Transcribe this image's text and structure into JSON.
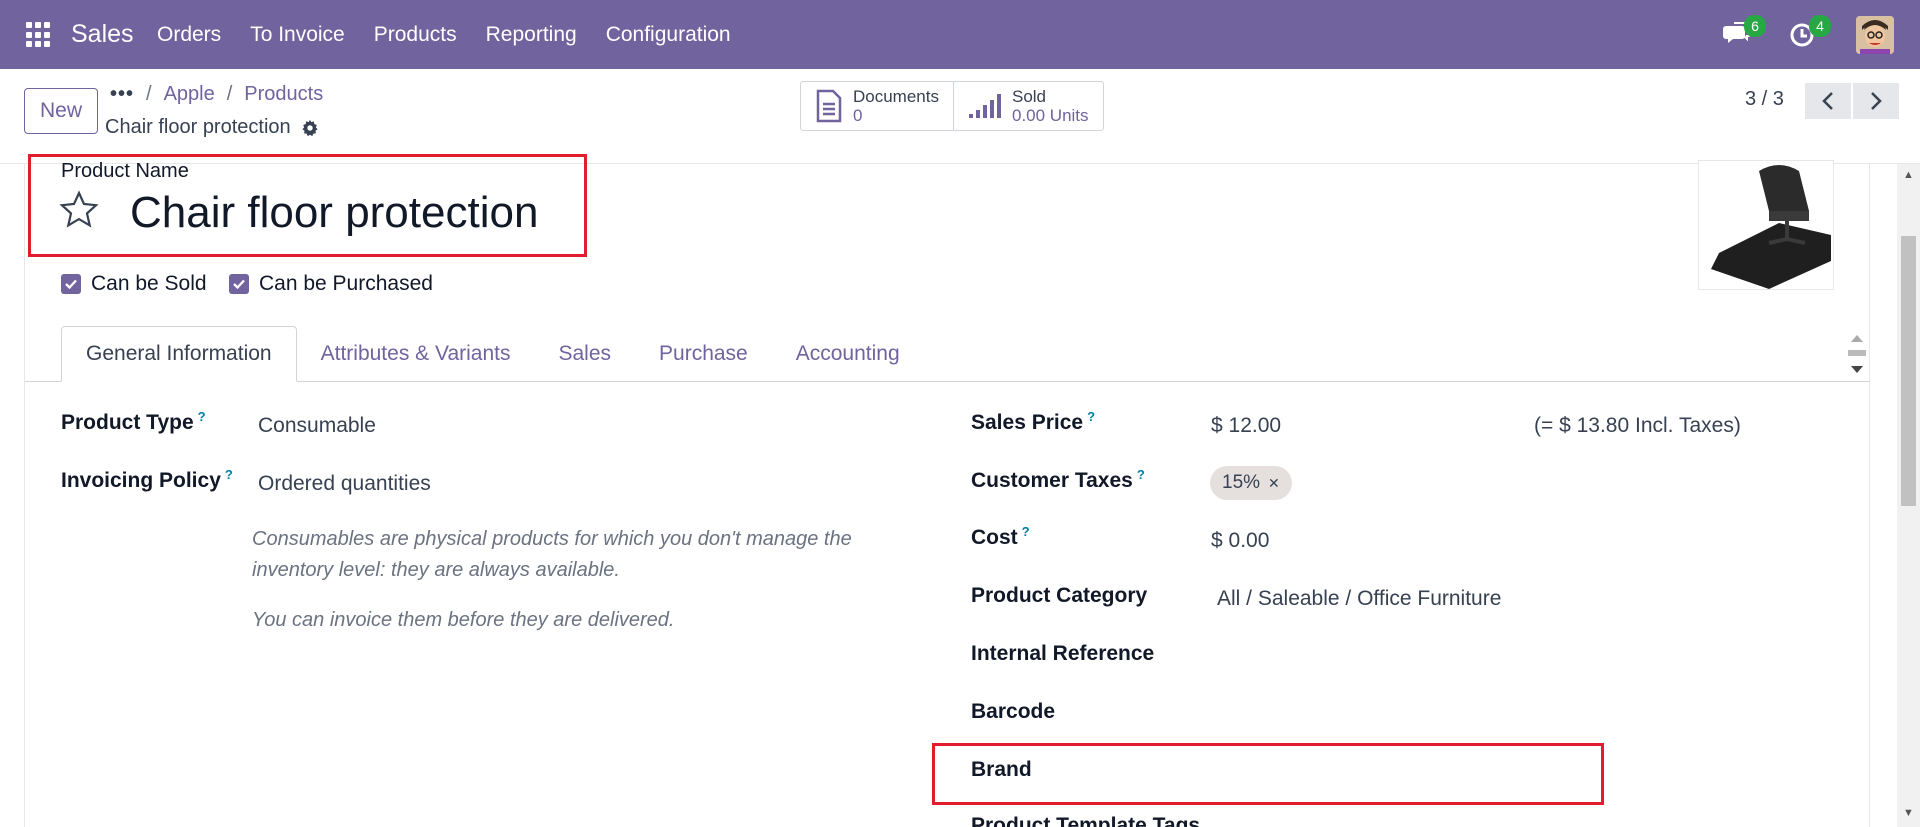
{
  "nav": {
    "app_name": "Sales",
    "menu": [
      "Orders",
      "To Invoice",
      "Products",
      "Reporting",
      "Configuration"
    ],
    "messages_badge": "6",
    "activities_badge": "4"
  },
  "control": {
    "new_label": "New",
    "breadcrumb_ellipsis": "•••",
    "breadcrumb": [
      "Apple",
      "Products"
    ],
    "record_title": "Chair floor protection",
    "smart_buttons": [
      {
        "label": "Documents",
        "value": "0"
      },
      {
        "label": "Sold",
        "value": "0.00 Units"
      }
    ],
    "pager": "3 / 3"
  },
  "form": {
    "product_name_label": "Product Name",
    "product_name": "Chair floor protection",
    "can_be_sold": "Can be Sold",
    "can_be_purchased": "Can be Purchased",
    "tabs": [
      "General Information",
      "Attributes & Variants",
      "Sales",
      "Purchase",
      "Accounting"
    ],
    "left": {
      "product_type_label": "Product Type",
      "product_type": "Consumable",
      "invoicing_policy_label": "Invoicing Policy",
      "invoicing_policy": "Ordered quantities",
      "hint1": "Consumables are physical products for which you don't manage the inventory level: they are always available.",
      "hint2": "You can invoice them before they are delivered."
    },
    "right": {
      "sales_price_label": "Sales Price",
      "sales_price": "$ 12.00",
      "incl_taxes": "(= $ 13.80 Incl. Taxes)",
      "customer_taxes_label": "Customer Taxes",
      "tax_tag": "15%",
      "cost_label": "Cost",
      "cost": "$ 0.00",
      "product_category_label": "Product Category",
      "product_category": "All / Saleable / Office Furniture",
      "internal_reference_label": "Internal Reference",
      "barcode_label": "Barcode",
      "brand_label": "Brand",
      "product_template_tags_label": "Product Template Tags"
    },
    "help_mark": "?"
  },
  "colors": {
    "brand": "#71639e",
    "highlight": "#e11d2e",
    "badge": "#28a745"
  }
}
